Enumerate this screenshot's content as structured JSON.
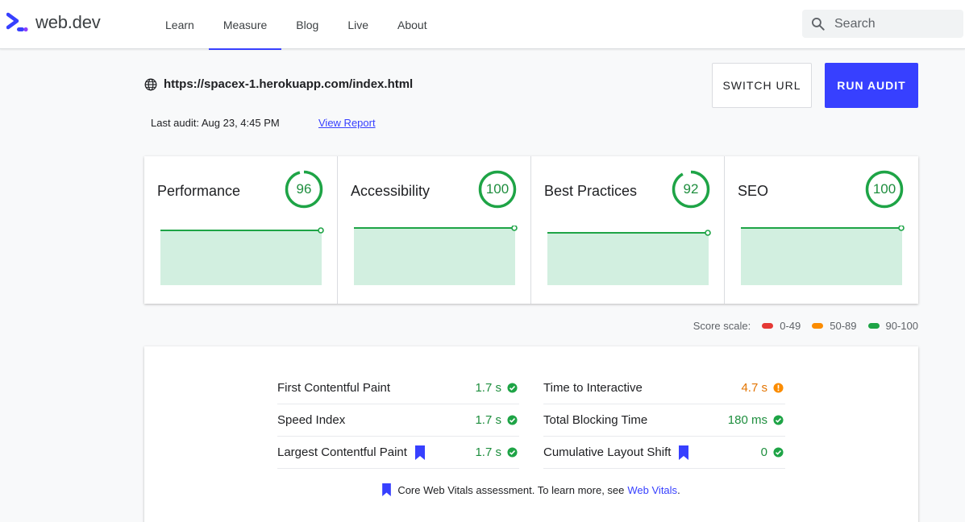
{
  "header": {
    "logo_text": "web.dev",
    "nav": [
      {
        "label": "Learn",
        "active": false
      },
      {
        "label": "Measure",
        "active": true
      },
      {
        "label": "Blog",
        "active": false
      },
      {
        "label": "Live",
        "active": false
      },
      {
        "label": "About",
        "active": false
      }
    ],
    "search_placeholder": "Search"
  },
  "audit": {
    "url": "https://spacex-1.herokuapp.com/index.html",
    "last_audit": "Last audit: Aug 23, 4:45 PM",
    "view_report": "View Report",
    "switch_url_label": "SWITCH URL",
    "run_audit_label": "RUN AUDIT"
  },
  "scores": [
    {
      "title": "Performance",
      "score": "96"
    },
    {
      "title": "Accessibility",
      "score": "100"
    },
    {
      "title": "Best Practices",
      "score": "92"
    },
    {
      "title": "SEO",
      "score": "100"
    }
  ],
  "score_scale": {
    "label": "Score scale:",
    "ranges": [
      {
        "label": "0-49",
        "color": "#e53935"
      },
      {
        "label": "50-89",
        "color": "#fb8c00"
      },
      {
        "label": "90-100",
        "color": "#1ea446"
      }
    ]
  },
  "metrics": {
    "left": [
      {
        "name": "First Contentful Paint",
        "value": "1.7 s",
        "status": "pass",
        "core": false
      },
      {
        "name": "Speed Index",
        "value": "1.7 s",
        "status": "pass",
        "core": false
      },
      {
        "name": "Largest Contentful Paint",
        "value": "1.7 s",
        "status": "pass",
        "core": true
      }
    ],
    "right": [
      {
        "name": "Time to Interactive",
        "value": "4.7 s",
        "status": "average",
        "core": false
      },
      {
        "name": "Total Blocking Time",
        "value": "180 ms",
        "status": "pass",
        "core": false
      },
      {
        "name": "Cumulative Layout Shift",
        "value": "0",
        "status": "pass",
        "core": true
      }
    ],
    "cwv_text": "Core Web Vitals assessment. To learn more, see",
    "cwv_link": "Web Vitals",
    "cwv_end": "."
  },
  "colors": {
    "accent": "#3740ff",
    "pass": "#1e8e3e",
    "average": "#e37400",
    "spark_fill": "#d2efe0",
    "spark_line": "#1ea446"
  }
}
